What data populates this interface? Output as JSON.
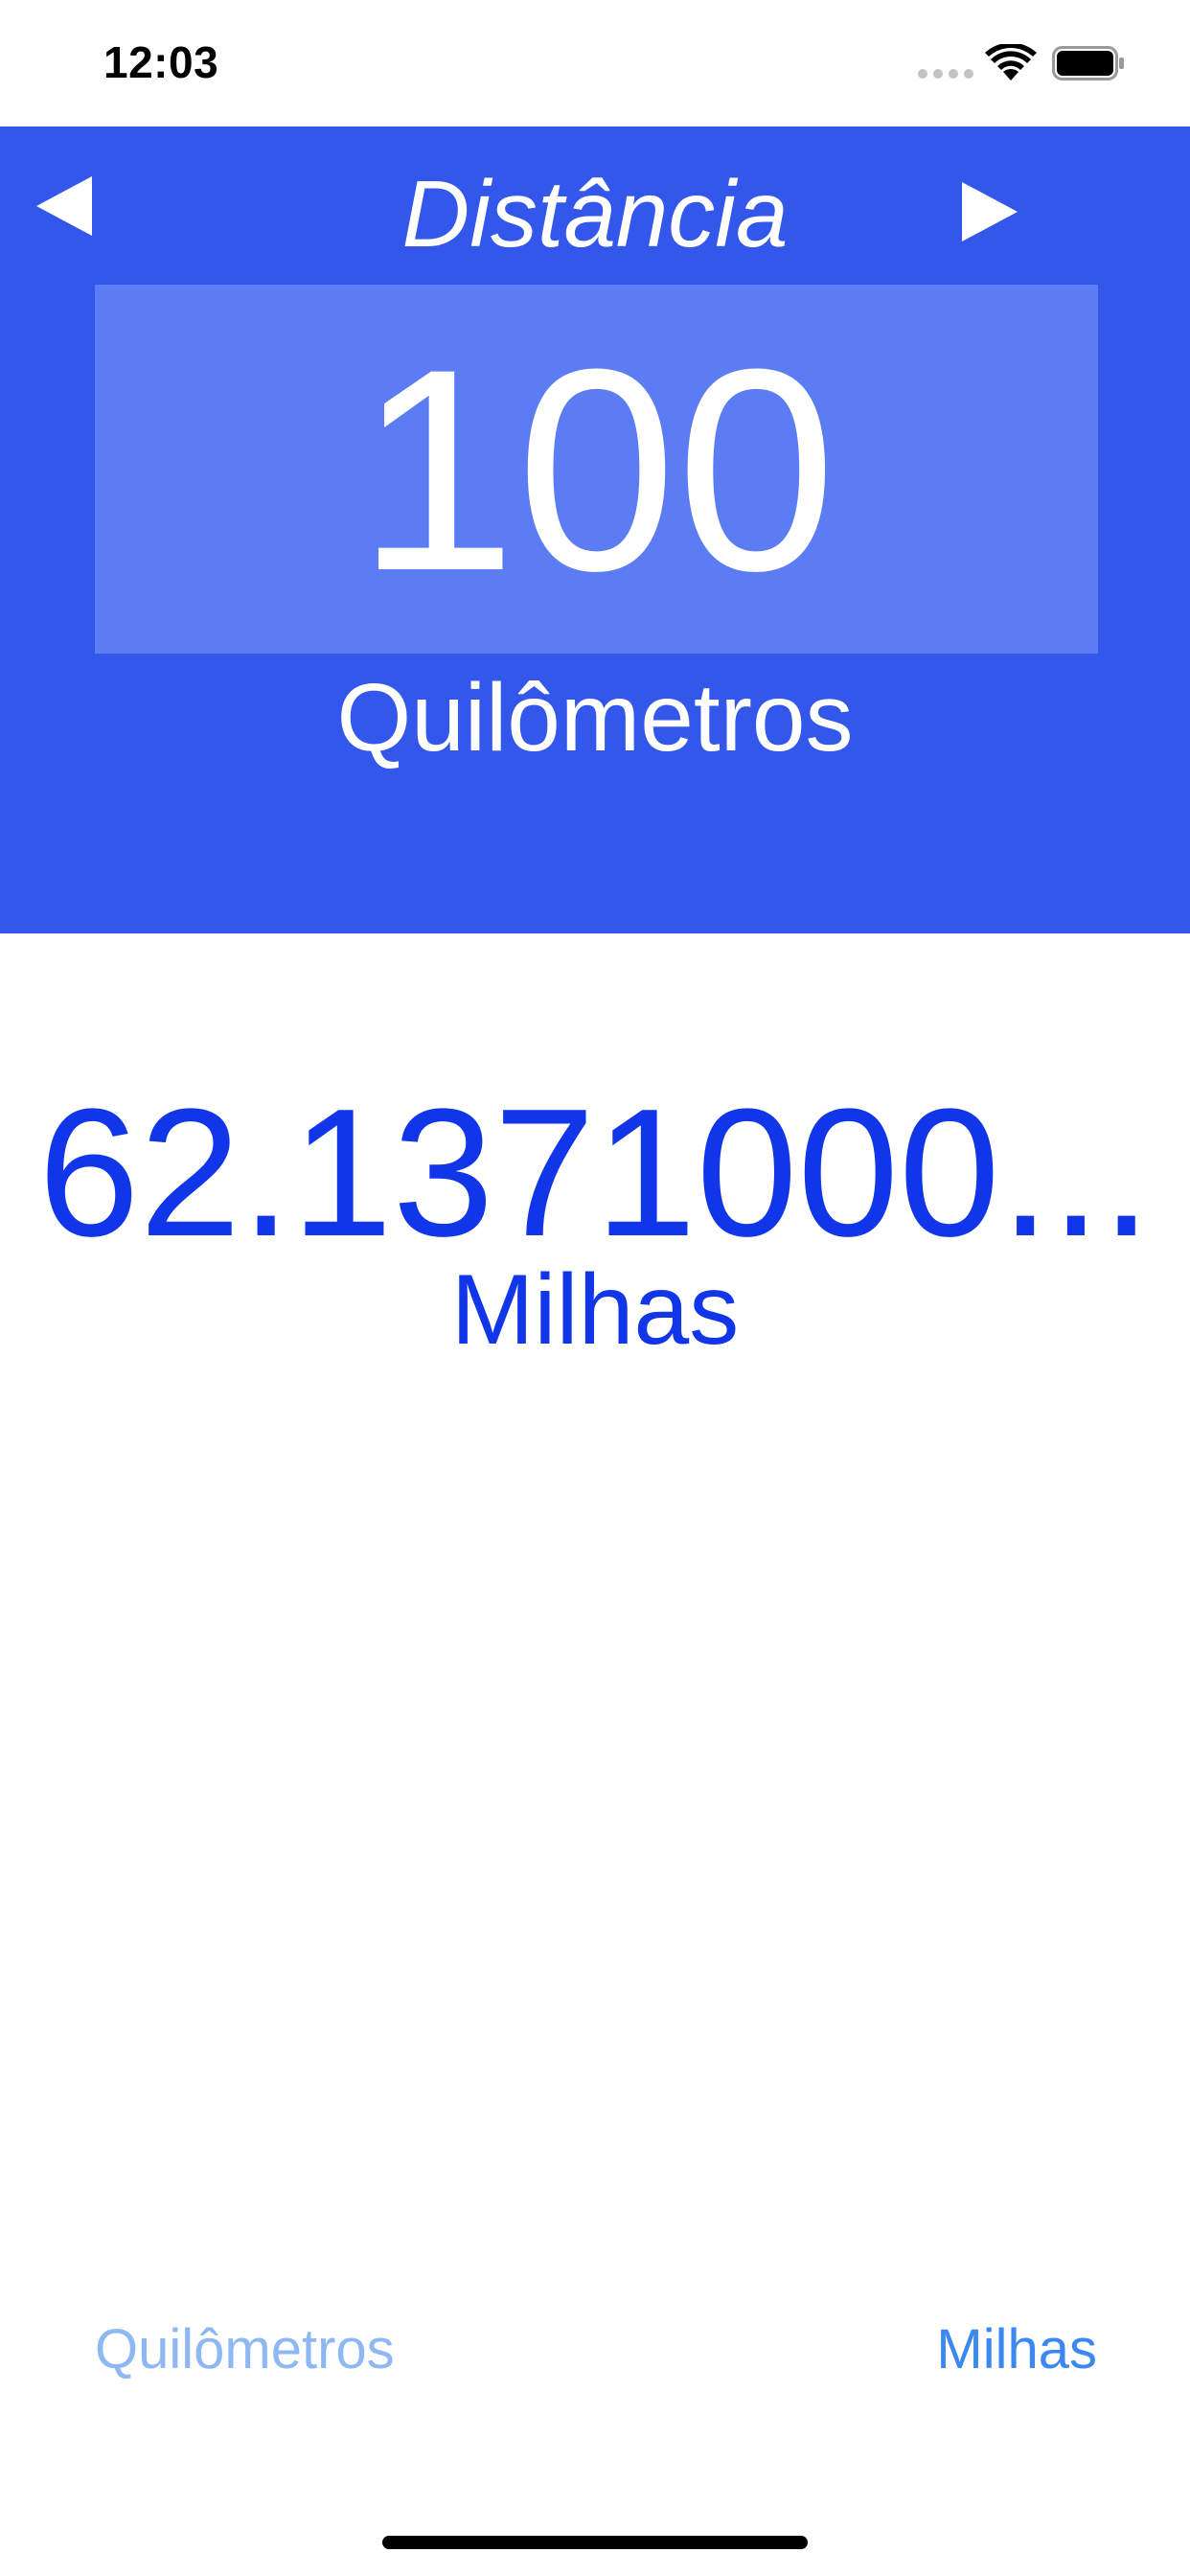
{
  "status_bar": {
    "time": "12:03",
    "icons": [
      "signal-dots-icon",
      "wifi-icon",
      "battery-icon"
    ]
  },
  "header": {
    "title": "Distância",
    "prev_icon": "left-triangle-icon",
    "next_icon": "right-triangle-icon",
    "input_value": "100",
    "from_unit": "Quilômetros"
  },
  "result": {
    "value": "62.1371000...",
    "unit": "Milhas"
  },
  "unit_selector": {
    "from": "Quilômetros",
    "to": "Milhas"
  },
  "colors": {
    "header_bg": "#3357EB",
    "input_bg": "#5B7CF2",
    "result_text": "#1135E8",
    "unit_from_text": "#8EB8F3",
    "unit_to_text": "#3A88F0"
  }
}
